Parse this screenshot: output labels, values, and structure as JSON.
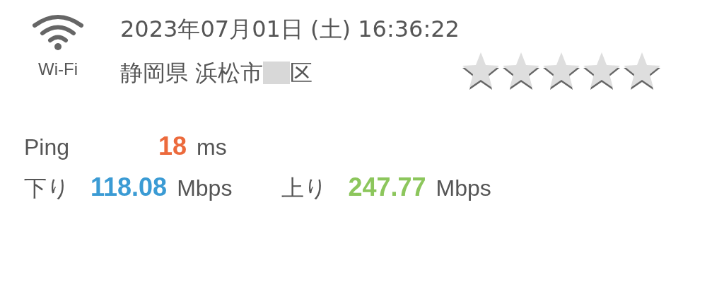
{
  "connection": {
    "label": "Wi-Fi"
  },
  "datetime": "2023年07月01日 (土) 16:36:22",
  "location": {
    "before_mask": "静岡県 浜松市",
    "after_mask": "区"
  },
  "rating": {
    "stars": 0
  },
  "rows": [
    [
      {
        "label": "Ping",
        "value": "18",
        "unit": "ms",
        "color": "#ec6a3c"
      }
    ],
    [
      {
        "label": "下り",
        "value": "118.08",
        "unit": "Mbps",
        "color": "#3b9bd4"
      },
      {
        "label": "上り",
        "value": "247.77",
        "unit": "Mbps",
        "color": "#8cc65c"
      }
    ]
  ]
}
